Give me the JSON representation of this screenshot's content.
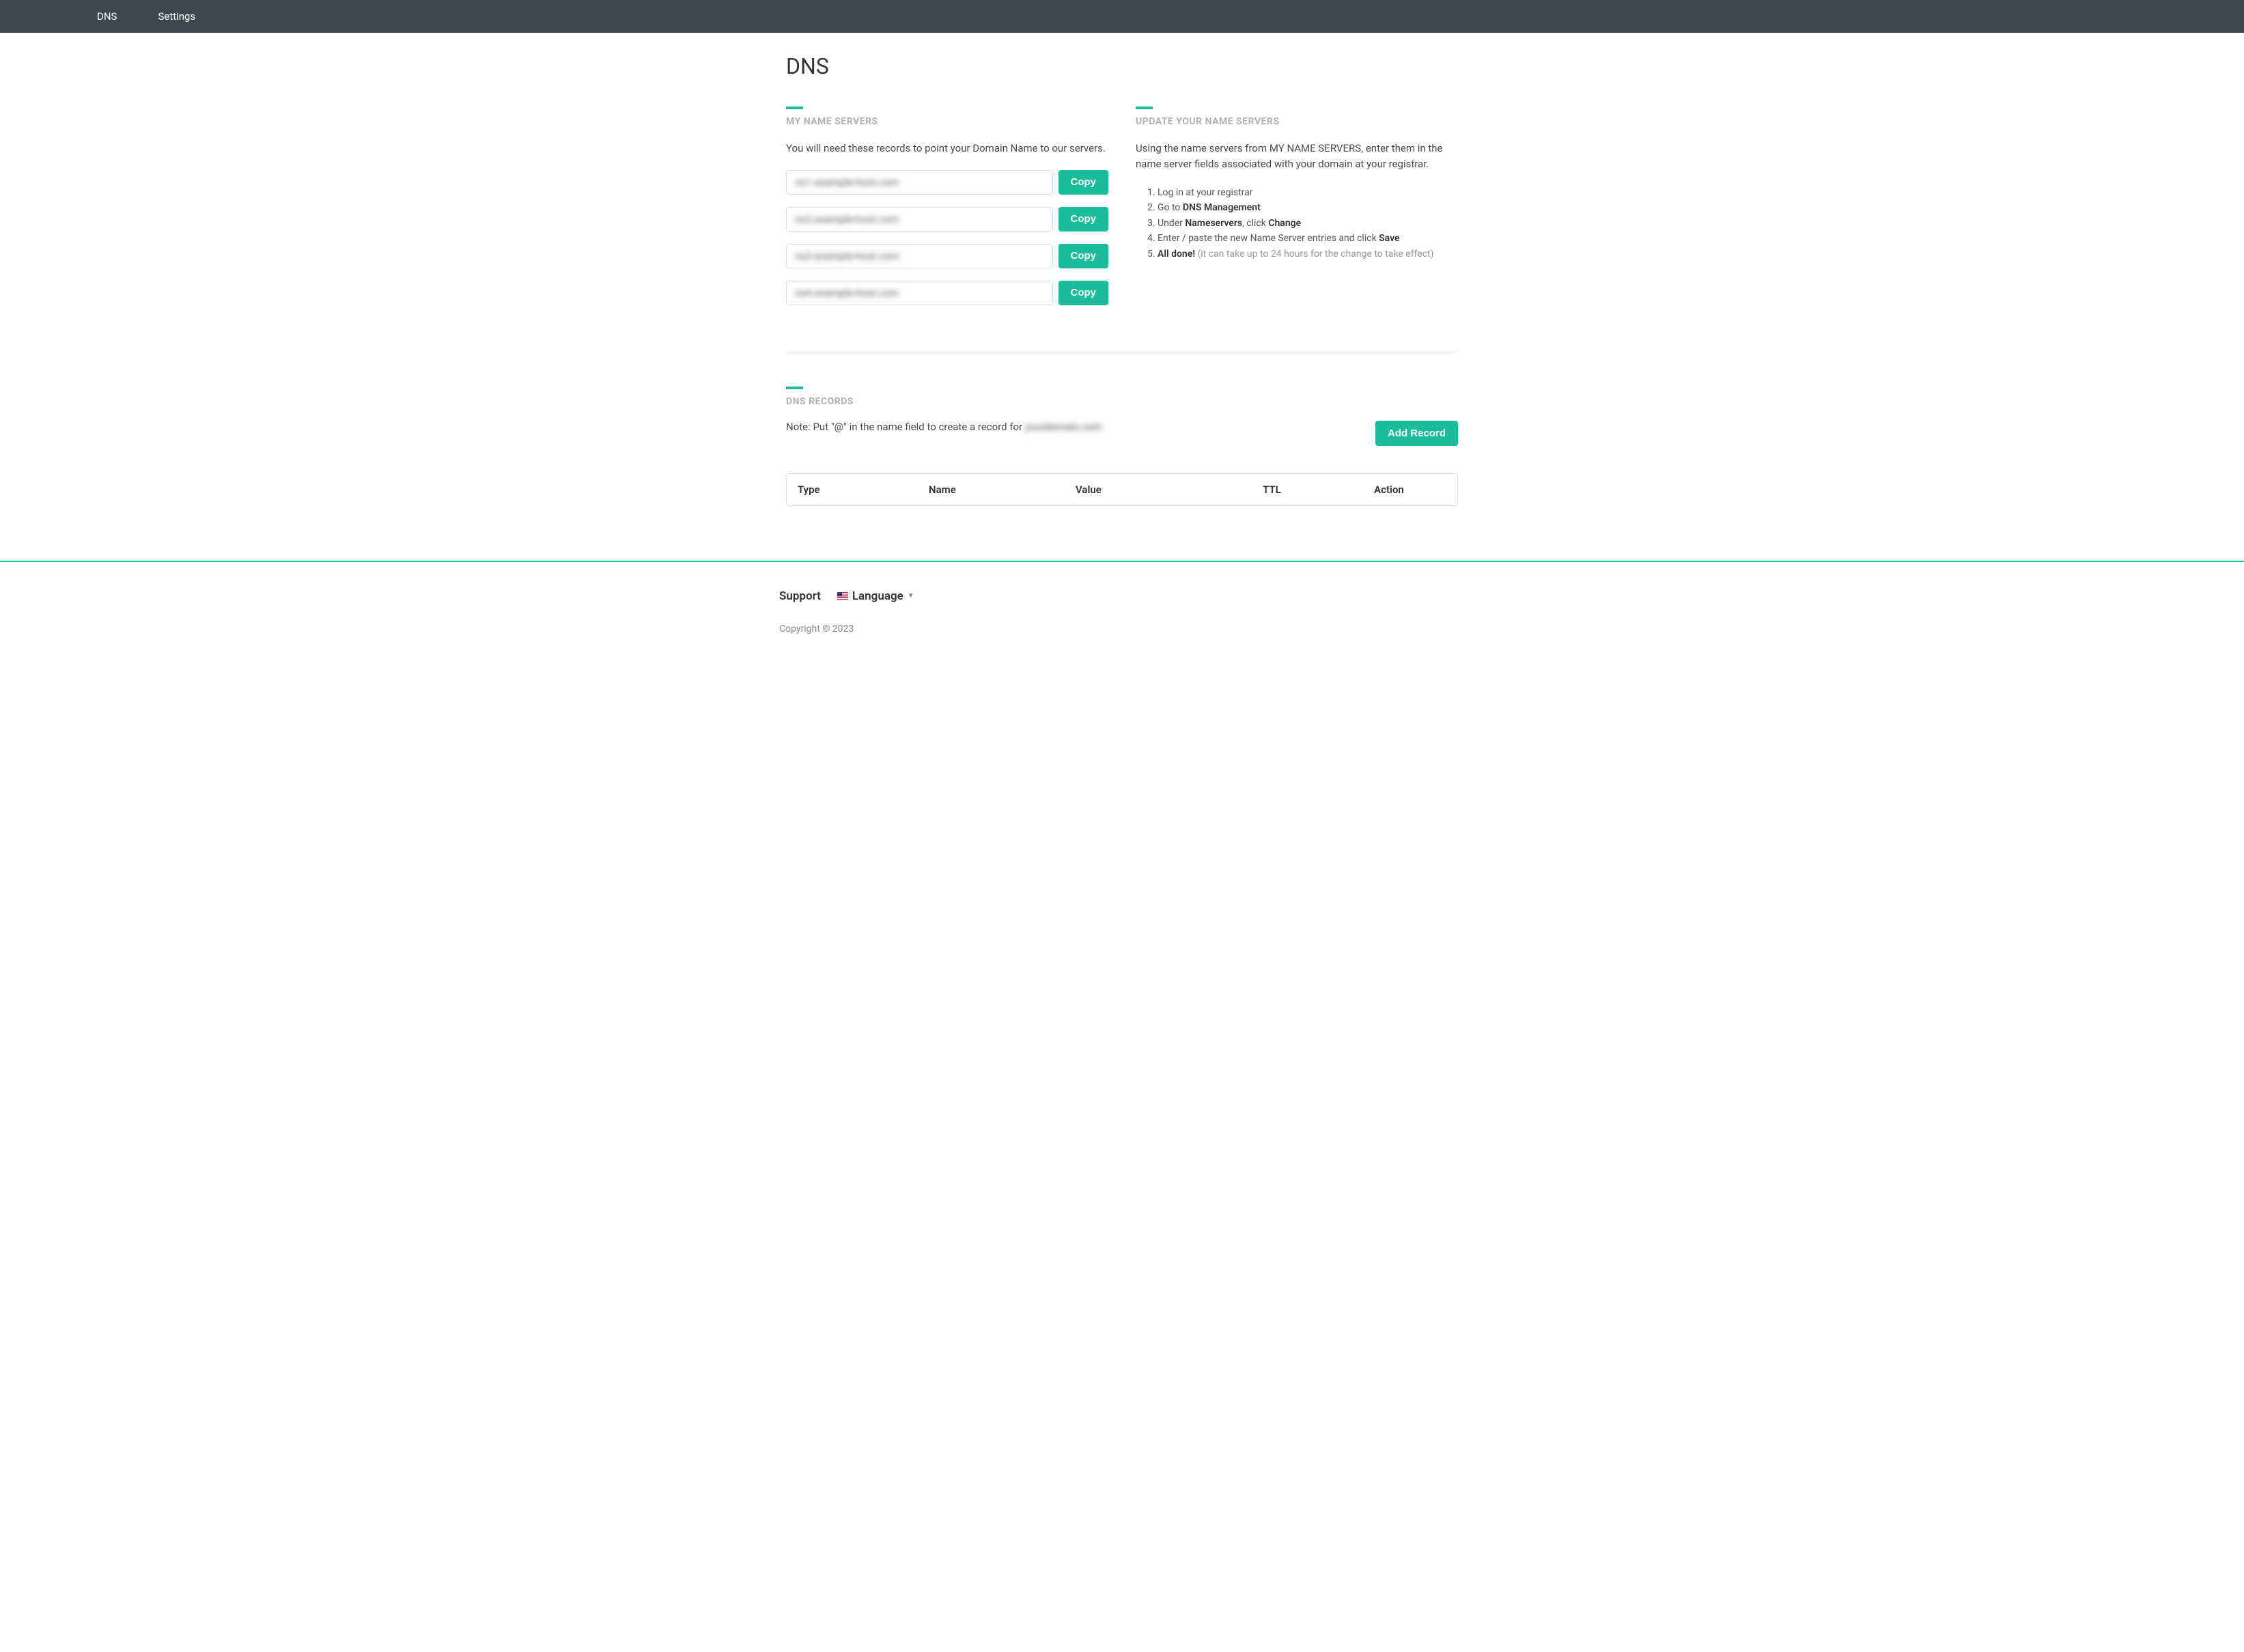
{
  "nav": {
    "dns": "DNS",
    "settings": "Settings"
  },
  "page": {
    "title": "DNS"
  },
  "nameservers": {
    "title": "MY NAME SERVERS",
    "desc": "You will need these records to point your Domain Name to our servers.",
    "copy_label": "Copy",
    "servers": [
      "ns1.example-host.com",
      "ns2.example-host.com",
      "ns3.example-host.com",
      "ns4.example-host.com"
    ]
  },
  "update": {
    "title": "UPDATE YOUR NAME SERVERS",
    "desc": "Using the name servers from MY NAME SERVERS, enter them in the name server fields associated with your domain at your registrar.",
    "step1": "Log in at your registrar",
    "step2_a": "Go to ",
    "step2_b": "DNS Management",
    "step3_a": "Under ",
    "step3_b": "Nameservers",
    "step3_c": ", click ",
    "step3_d": "Change",
    "step4_a": "Enter / paste the new Name Server entries and click ",
    "step4_b": "Save",
    "step5_a": "All done!",
    "step5_b": " (it can take up to 24 hours for the change to take effect)"
  },
  "records": {
    "title": "DNS RECORDS",
    "note_prefix": "Note: Put \"@\" in the name field to create a record for ",
    "note_domain": "yourdomain.com",
    "add_label": "Add Record",
    "headers": {
      "type": "Type",
      "name": "Name",
      "value": "Value",
      "ttl": "TTL",
      "action": "Action"
    }
  },
  "footer": {
    "support": "Support",
    "language": "Language",
    "copyright": "Copyright © 2023"
  }
}
